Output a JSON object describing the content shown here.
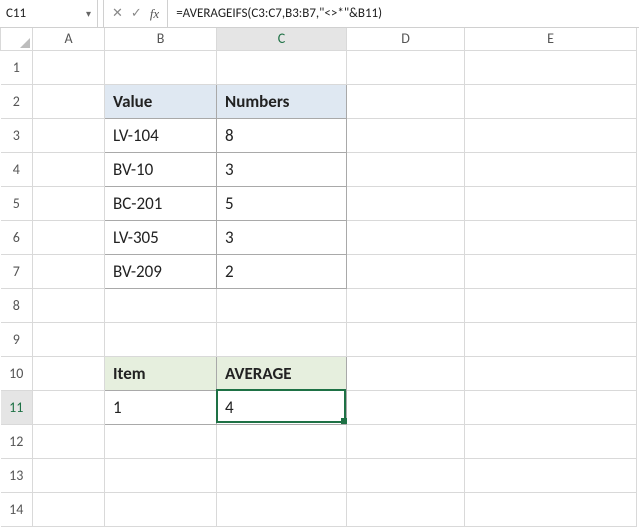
{
  "name_box": "C11",
  "formula": "=AVERAGEIFS(C3:C7,B3:B7,\"<>*\"&B11)",
  "columns": [
    "A",
    "B",
    "C",
    "D",
    "E"
  ],
  "rows": [
    "1",
    "2",
    "3",
    "4",
    "5",
    "6",
    "7",
    "8",
    "9",
    "10",
    "11",
    "12",
    "13",
    "14"
  ],
  "table1": {
    "headers": {
      "b": "Value",
      "c": "Numbers"
    },
    "rows": [
      {
        "b": "LV-104",
        "c": "8"
      },
      {
        "b": "BV-10",
        "c": "3"
      },
      {
        "b": "BC-201",
        "c": "5"
      },
      {
        "b": "LV-305",
        "c": "3"
      },
      {
        "b": "BV-209",
        "c": "2"
      }
    ]
  },
  "table2": {
    "headers": {
      "b": "Item",
      "c": "AVERAGE"
    },
    "row": {
      "b": "1",
      "c": "4"
    }
  },
  "active_cell": "C11",
  "colors": {
    "accent": "#1e7145"
  },
  "chart_data": {
    "type": "table",
    "tables": [
      {
        "title": "Values",
        "columns": [
          "Value",
          "Numbers"
        ],
        "rows": [
          [
            "LV-104",
            8
          ],
          [
            "BV-10",
            3
          ],
          [
            "BC-201",
            5
          ],
          [
            "LV-305",
            3
          ],
          [
            "BV-209",
            2
          ]
        ]
      },
      {
        "title": "Result",
        "columns": [
          "Item",
          "AVERAGE"
        ],
        "rows": [
          [
            1,
            4
          ]
        ]
      }
    ]
  }
}
